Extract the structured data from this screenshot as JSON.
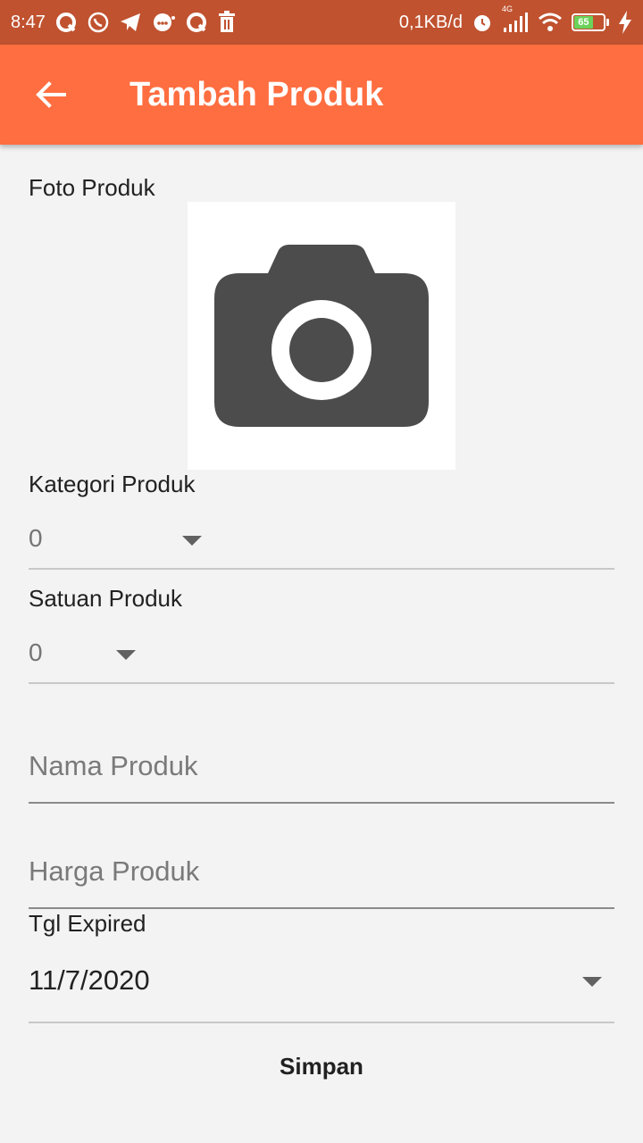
{
  "status_bar": {
    "time": "8:47",
    "network_speed": "0,1KB/d",
    "network_type": "4G",
    "battery_level": "65",
    "icons_left": [
      "q-app-icon",
      "whatsapp-icon",
      "telegram-icon",
      "messenger-icon",
      "q-app-icon",
      "delete-icon"
    ],
    "icons_right": [
      "alarm-icon",
      "signal-icon",
      "wifi-icon",
      "battery-icon",
      "charging-icon"
    ]
  },
  "app_bar": {
    "title": "Tambah Produk",
    "back_icon": "arrow-back-icon",
    "color": "#ff6e40"
  },
  "form": {
    "photo": {
      "label": "Foto Produk",
      "icon": "camera-icon"
    },
    "category": {
      "label": "Kategori Produk",
      "value": "0"
    },
    "unit": {
      "label": "Satuan Produk",
      "value": "0"
    },
    "name": {
      "placeholder": "Nama Produk",
      "value": ""
    },
    "price": {
      "placeholder": "Harga Produk",
      "value": ""
    },
    "expired": {
      "label": "Tgl Expired",
      "value": "11/7/2020"
    },
    "submit_label": "Simpan"
  },
  "colors": {
    "status_bar": "#c0522f",
    "app_bar": "#ff6e40",
    "background": "#f3f3f3",
    "camera_icon": "#4c4c4c"
  }
}
